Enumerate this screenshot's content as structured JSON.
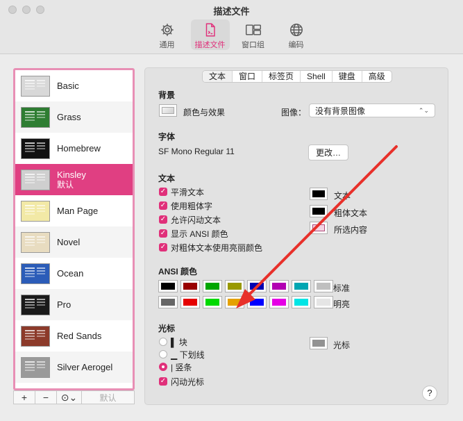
{
  "window": {
    "title": "描述文件"
  },
  "toolbar": {
    "tabs": [
      {
        "label": "通用",
        "icon": "gear-icon"
      },
      {
        "label": "描述文件",
        "icon": "profile-doc-icon"
      },
      {
        "label": "窗口组",
        "icon": "window-group-icon"
      },
      {
        "label": "编码",
        "icon": "globe-icon"
      }
    ],
    "active": "描述文件"
  },
  "profiles": {
    "items": [
      {
        "name": "Basic",
        "bg": "#d8d8d8"
      },
      {
        "name": "Grass",
        "bg": "#2e7d32"
      },
      {
        "name": "Homebrew",
        "bg": "#111111"
      },
      {
        "name": "Kinsley",
        "bg": "#cfcfcf",
        "default": "默认"
      },
      {
        "name": "Man Page",
        "bg": "#f2e9a6"
      },
      {
        "name": "Novel",
        "bg": "#e8dcc0"
      },
      {
        "name": "Ocean",
        "bg": "#2b5cb8"
      },
      {
        "name": "Pro",
        "bg": "#1a1a1a"
      },
      {
        "name": "Red Sands",
        "bg": "#8c3a2a"
      },
      {
        "name": "Silver Aerogel",
        "bg": "#9a9a9a"
      }
    ],
    "selected": "Kinsley",
    "add_label": "+",
    "remove_label": "−",
    "more_label": "⊙⌄",
    "default_label": "默认"
  },
  "segments": [
    "文本",
    "窗口",
    "标签页",
    "Shell",
    "键盘",
    "高级"
  ],
  "background": {
    "title": "背景",
    "color_label": "颜色与效果",
    "image_label": "图像：",
    "image_value": "没有背景图像"
  },
  "font": {
    "title": "字体",
    "value": "SF Mono Regular 11",
    "change_button": "更改…"
  },
  "text": {
    "title": "文本",
    "checkboxes": [
      "平滑文本",
      "使用粗体字",
      "允许闪动文本",
      "显示 ANSI 颜色",
      "对粗体文本使用亮丽颜色"
    ],
    "colors": [
      {
        "label": "文本",
        "color": "#000000"
      },
      {
        "label": "粗体文本",
        "color": "#000000"
      },
      {
        "label": "所选内容",
        "color": "#f3d4e2"
      }
    ]
  },
  "ansi": {
    "title": "ANSI 颜色",
    "normal_label": "标准",
    "bright_label": "明亮",
    "normal": [
      "#000000",
      "#990000",
      "#00a600",
      "#999900",
      "#0000b2",
      "#b200b2",
      "#00a6b2",
      "#bfbfbf"
    ],
    "bright": [
      "#666666",
      "#e50000",
      "#00d900",
      "#e5a100",
      "#0000ff",
      "#e500e5",
      "#00e5e5",
      "#e5e5e5"
    ]
  },
  "cursor": {
    "title": "光标",
    "options": [
      {
        "label": "▌ 块",
        "on": false
      },
      {
        "label": "▁ 下划线",
        "on": false
      },
      {
        "label": "| 竖条",
        "on": true
      }
    ],
    "blink_label": "闪动光标",
    "color_label": "光标",
    "color": "#929292"
  },
  "help_label": "?",
  "annotation": {
    "color": "#e8302a"
  }
}
